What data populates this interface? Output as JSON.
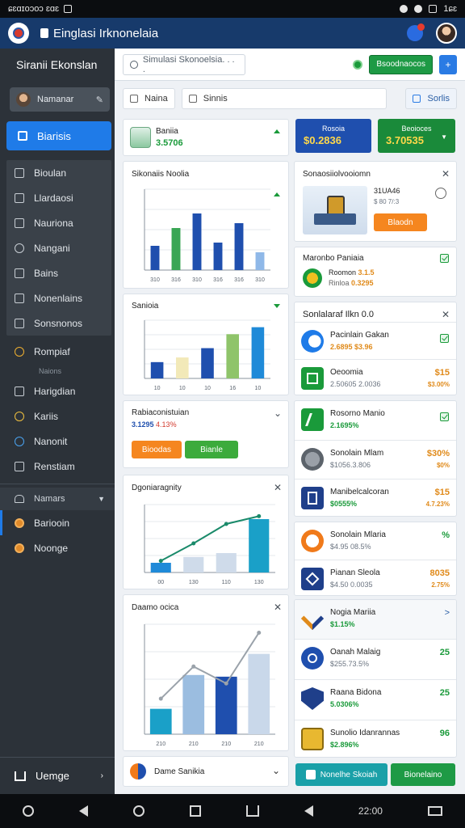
{
  "statusbar": {
    "left_text": "ɕɛɑɪoɔoɔ ɛɑɛ",
    "right_text": "1ɕɛ"
  },
  "app": {
    "title": "Einglasi Irknonelaia"
  },
  "sidebar": {
    "title": "Siranii Ekonslan",
    "user": {
      "name": "Namanar"
    },
    "active_item": "Biarisis",
    "group_items": [
      {
        "label": "Bioulan",
        "icon": "box-icon"
      },
      {
        "label": "Llardaosi",
        "icon": "grid-icon"
      },
      {
        "label": "Nauriona",
        "icon": "tag-icon"
      },
      {
        "label": "Nangani",
        "icon": "circle-icon"
      },
      {
        "label": "Bains",
        "icon": "doc-icon"
      },
      {
        "label": "Nonenlains",
        "icon": "list-icon"
      },
      {
        "label": "Sonsnonos",
        "icon": "folder-icon"
      }
    ],
    "plain_items": [
      {
        "label": "Rompiaf",
        "icon": "bell-icon",
        "sub": "Naions"
      },
      {
        "label": "Harigdian",
        "icon": "cart-icon"
      },
      {
        "label": "Kariis",
        "icon": "smile-icon"
      },
      {
        "label": "Nanonit",
        "icon": "target-icon"
      },
      {
        "label": "Renstiam",
        "icon": "card-icon"
      }
    ],
    "section": {
      "label": "Namars",
      "icon": "users-icon"
    },
    "section_items": [
      {
        "label": "Bariooin"
      },
      {
        "label": "Noonge"
      }
    ],
    "footer_label": "Uemge"
  },
  "toolbar": {
    "search_placeholder": "Simulasi Skonoelsia. . . .",
    "action_label": "Bsoodnaocos",
    "plus_label": "+"
  },
  "tabs": [
    {
      "label": "Naina"
    },
    {
      "label": "Sinnis"
    },
    {
      "label": "Sorlis"
    }
  ],
  "cards": {
    "summary": {
      "title": "Baniia",
      "value": "3.5706"
    },
    "kpi_blue": {
      "label": "Rosoia",
      "value": "$0.2836"
    },
    "kpi_green": {
      "label": "Beoioces",
      "value": "3.70535"
    },
    "chart1_title": "Sikonaiis Noolia",
    "product": {
      "title": "Sonaosiiolvooiomn",
      "line1": "31UA46",
      "line2": "$ 80 7/:3",
      "button": "Blaodn"
    },
    "chart2_title": "Sanioia",
    "member": {
      "title": "Maronbo Paniaia",
      "sub1": "Roomon",
      "sub1_val": "3.1.5",
      "sub2": "Rinloa",
      "sub2_val": "0.3295"
    },
    "promo": {
      "title": "Rabiaconistuian",
      "value": "3.1295",
      "red": "4.13%",
      "btn_orange": "Bioodas",
      "btn_green": "Bianle"
    },
    "list1_title": "Sonlalaraf Ilkn 0.0",
    "chart3_title": "Dgoniaragnity",
    "chart4_title": "Daamo ocica",
    "bottom_left": "Dame Sanikia",
    "bottom_btn1": "Nonelhe Skoiah",
    "bottom_btn2": "Bionelaino"
  },
  "list1": [
    {
      "title": "Pacinlain Gakan",
      "sub": "2.6895 $3.96",
      "check": true
    },
    {
      "title": "Oeoomia",
      "sub": "2.50605 2.0036",
      "right": "$15",
      "right2": "$3.00%"
    },
    {
      "title": "Rosorno Manio",
      "sub": "2.1695%",
      "check": true
    },
    {
      "title": "Sonolain Mlam",
      "sub": "$1056.3.806",
      "right": "$30%",
      "right2": "$0%"
    },
    {
      "title": "Manibelcalcoran",
      "sub": "$0555%",
      "right": "$15",
      "right2": "4.7.23%"
    }
  ],
  "list2": [
    {
      "title": "Sonolain Mlaria",
      "sub": "$4.95 08.5%",
      "right": "%"
    },
    {
      "title": "Pianan Sleola",
      "sub": "$4.50 0.0035",
      "right": "8035",
      "right2": "2.75%"
    }
  ],
  "list3": [
    {
      "title": "Nogia Mariia",
      "sub": "$1.15%",
      "right": ">"
    },
    {
      "title": "Oanah Malaig",
      "sub": "$255.73.5%",
      "right": "25"
    },
    {
      "title": "Raana Bidona",
      "sub": "5.0306%",
      "right": "25"
    },
    {
      "title": "Sunolio Idanrannas",
      "sub": "$2.896%",
      "right": "96"
    }
  ],
  "colors": {
    "brand": "#173a6b",
    "accent": "#1f7be8",
    "positive": "#1a9a3a",
    "warning": "#e08a1a"
  },
  "chart_data": [
    {
      "type": "bar",
      "title": "Sikonaiis Noolia",
      "categories": [
        "310",
        "316",
        "310",
        "316",
        "316",
        "310"
      ],
      "series": [
        {
          "values": [
            30,
            52,
            70,
            34,
            58,
            22
          ]
        }
      ],
      "ylim": [
        0,
        100
      ],
      "colors": [
        "#1f4fae",
        "#3aa655",
        "#1f4fae",
        "#1f4fae",
        "#1f4fae",
        "#8fb8e8"
      ]
    },
    {
      "type": "bar",
      "title": "Sanioia",
      "categories": [
        "10",
        "10",
        "10",
        "16",
        "10"
      ],
      "series": [
        {
          "values": [
            14,
            18,
            26,
            38,
            44
          ]
        }
      ],
      "ylim": [
        0,
        50
      ],
      "colors": [
        "#1f4fae",
        "#f2e9b8",
        "#1f4fae",
        "#8fc46a",
        "#1f8ad8"
      ]
    },
    {
      "type": "bar",
      "title": "Dgoniaragnity",
      "categories": [
        "00",
        "130",
        "110",
        "130"
      ],
      "series": [
        {
          "values": [
            10,
            16,
            20,
            55
          ]
        }
      ],
      "line": [
        12,
        30,
        50,
        58
      ],
      "ylim": [
        0,
        70
      ]
    },
    {
      "type": "bar",
      "title": "Daamo ocica",
      "categories": [
        "210",
        "210",
        "210",
        "210"
      ],
      "series": [
        {
          "values": [
            30,
            70,
            68,
            95
          ]
        }
      ],
      "line": [
        42,
        80,
        60,
        120
      ],
      "ylim": [
        0,
        130
      ]
    }
  ],
  "navbar": {
    "time": "22:00"
  }
}
